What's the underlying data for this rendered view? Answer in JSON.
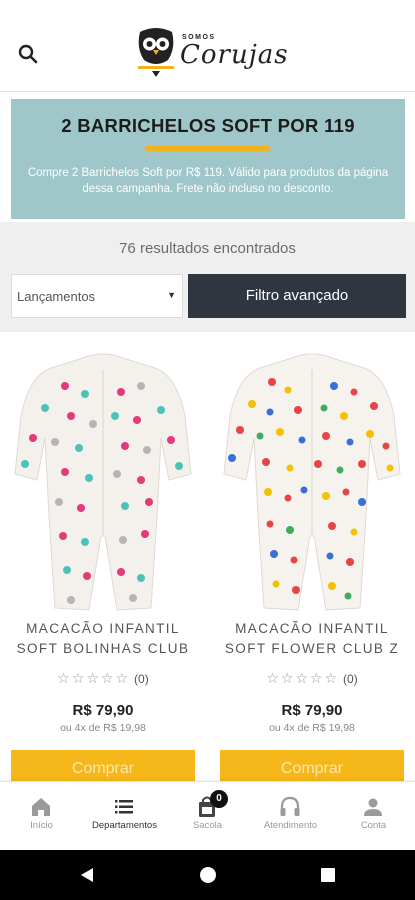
{
  "header": {
    "logo_small": "SOMOS",
    "logo_main": "Corujas"
  },
  "banner": {
    "title": "2 BARRICHELOS SOFT POR 119",
    "text": "Compre 2 Barrichelos Soft por R$ 119. Válido para produtos da página dessa campanha. Frete não incluso no desconto.",
    "background": "#9fc7c9",
    "accent": "#f2b21a"
  },
  "filters": {
    "results": "76 resultados encontrados",
    "sort_selected": "Lançamentos",
    "advanced_filter": "Filtro avançado"
  },
  "products": [
    {
      "name_line1": "MACACÃO INFANTIL",
      "name_line2": "SOFT BOLINHAS CLUB",
      "stars": "☆☆☆☆☆",
      "rating_count": "(0)",
      "price": "R$ 79,90",
      "installments": "ou 4x de R$ 19,98",
      "buy_label": "Comprar"
    },
    {
      "name_line1": "MACACÃO INFANTIL",
      "name_line2": "SOFT FLOWER CLUB Z",
      "stars": "☆☆☆☆☆",
      "rating_count": "(0)",
      "price": "R$ 79,90",
      "installments": "ou 4x de R$ 19,98",
      "buy_label": "Comprar"
    }
  ],
  "bottom_nav": {
    "items": [
      {
        "label": "Início",
        "icon": "home-icon"
      },
      {
        "label": "Departamentos",
        "icon": "menu-icon"
      },
      {
        "label": "Sacola",
        "icon": "bag-icon",
        "badge": "0"
      },
      {
        "label": "Atendimento",
        "icon": "headphones-icon"
      },
      {
        "label": "Conta",
        "icon": "user-icon"
      }
    ],
    "active_index": 1
  },
  "colors": {
    "buy_button": "#f5b719",
    "filter_button": "#2f3640"
  }
}
